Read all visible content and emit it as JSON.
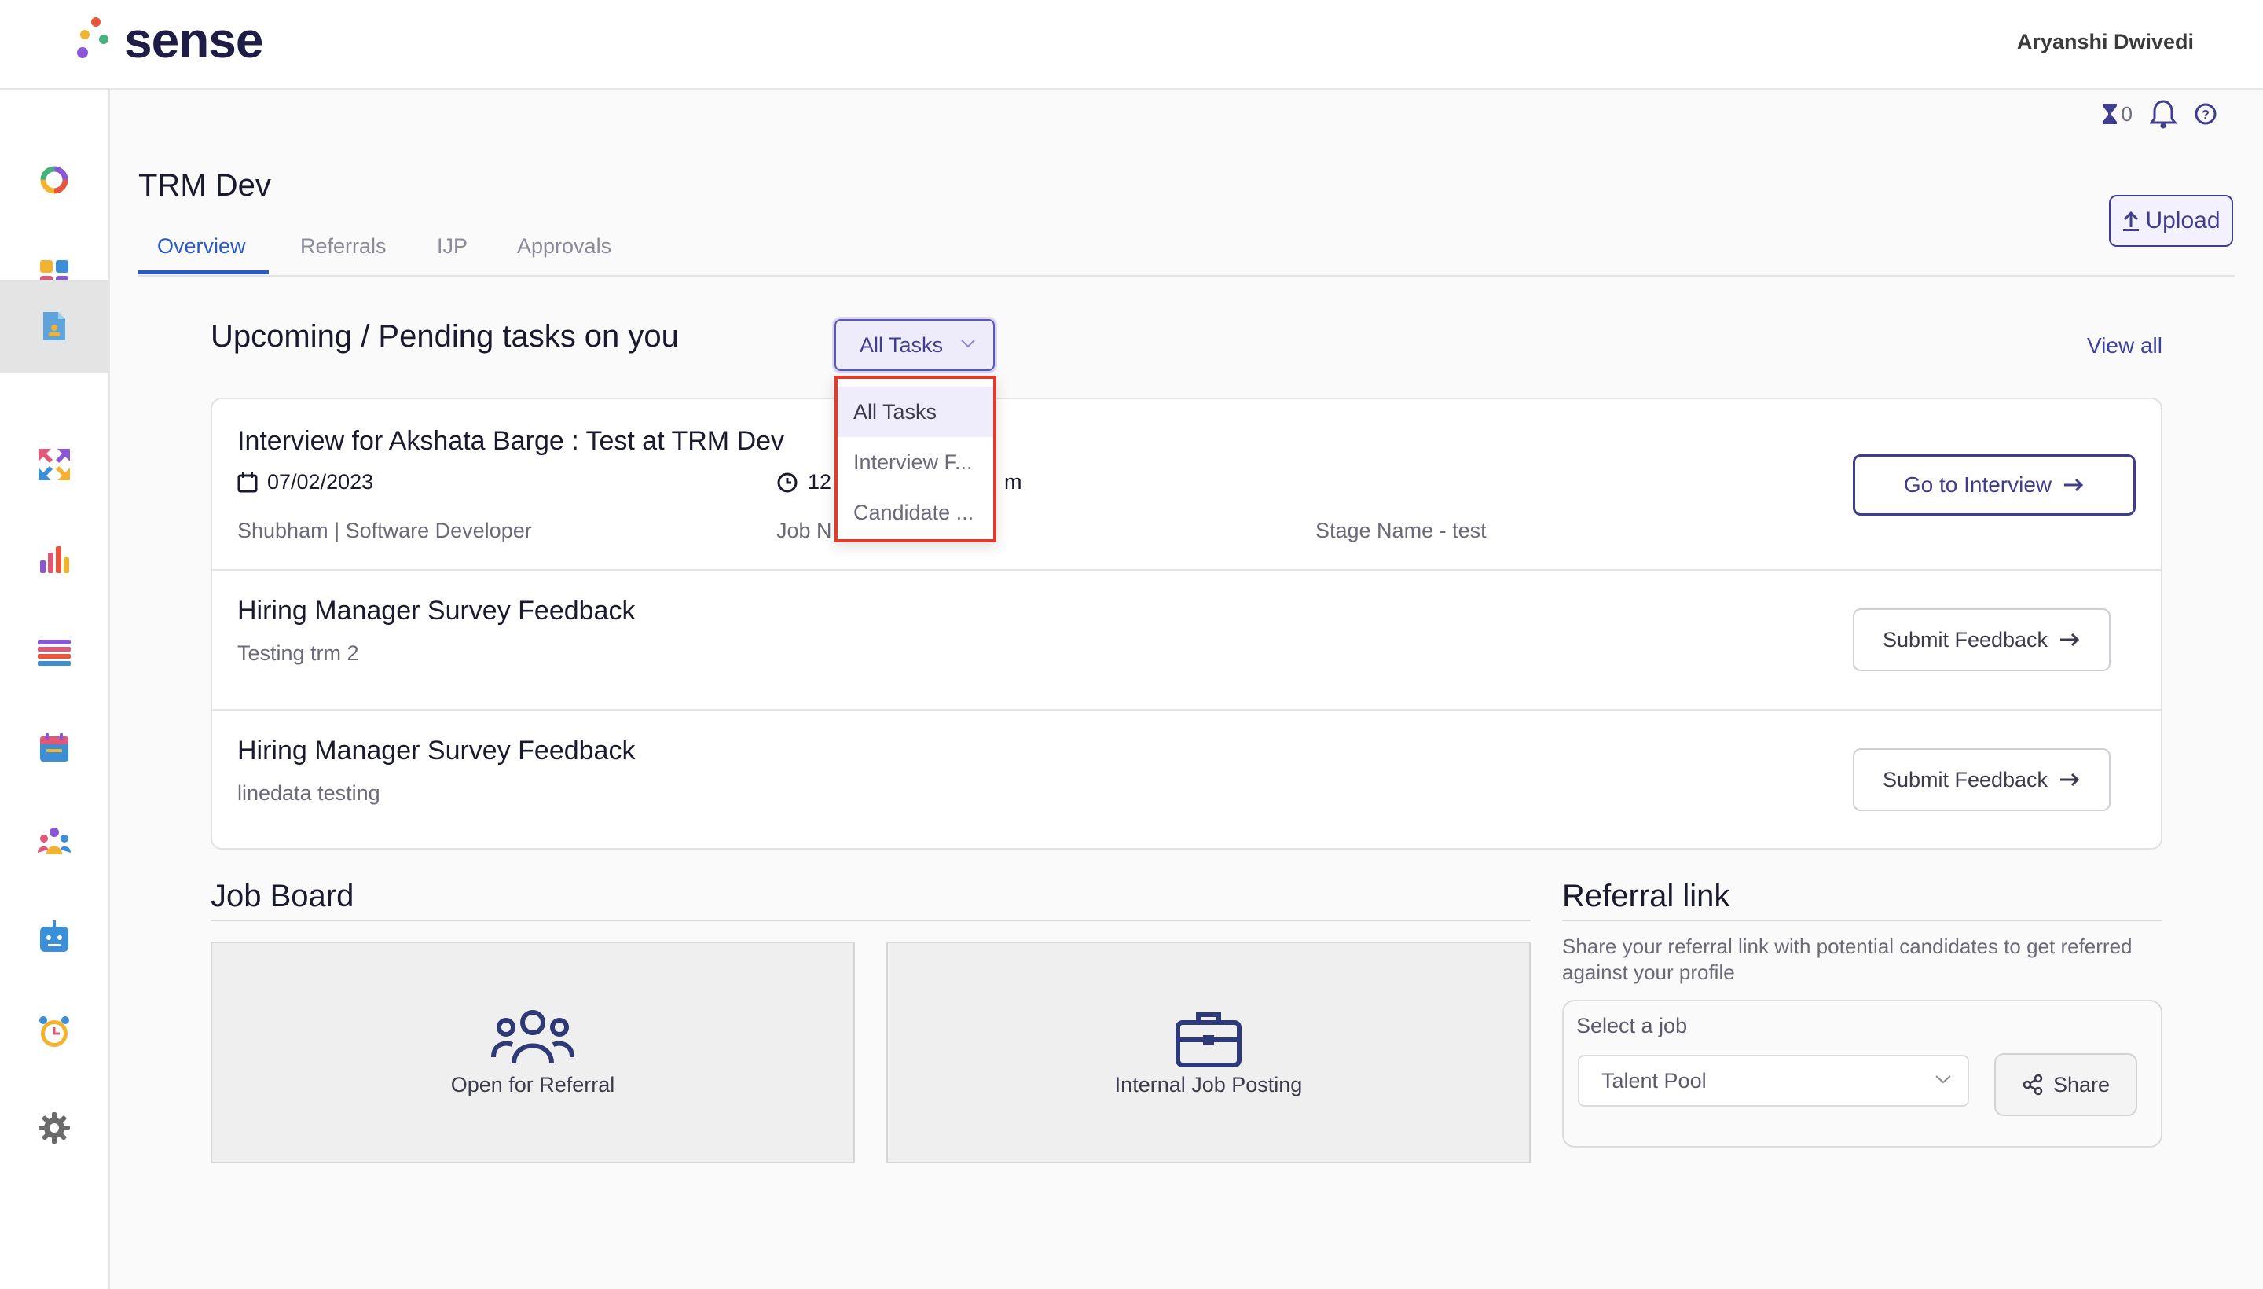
{
  "app": {
    "name": "sense",
    "user": "Aryanshi Dwivedi"
  },
  "colors": {
    "accent": "#3f3d8f",
    "tab_active": "#2b58c4",
    "highlight_box": "#e03c2d"
  },
  "sidebar": {
    "items": [
      {
        "icon": "donut-chart-icon"
      },
      {
        "icon": "dashboard-grid-icon"
      },
      {
        "icon": "referral-document-icon",
        "active": true
      },
      {
        "icon": "arrows-exchange-icon"
      },
      {
        "icon": "bar-chart-icon"
      },
      {
        "icon": "list-icon"
      },
      {
        "icon": "calendar-icon"
      },
      {
        "icon": "people-group-icon"
      },
      {
        "icon": "bot-icon"
      },
      {
        "icon": "alarm-clock-icon"
      },
      {
        "icon": "gear-icon"
      }
    ]
  },
  "iconbar": {
    "hourglass_count": "0"
  },
  "page": {
    "title": "TRM Dev",
    "tabs": [
      {
        "label": "Overview",
        "active": true
      },
      {
        "label": "Referrals"
      },
      {
        "label": "IJP"
      },
      {
        "label": "Approvals"
      }
    ],
    "upload_label": "Upload"
  },
  "tasks": {
    "heading": "Upcoming / Pending tasks on you",
    "view_all": "View all",
    "filter": {
      "selected": "All Tasks",
      "options": [
        "All Tasks",
        "Interview F...",
        "Candidate ..."
      ]
    },
    "items": [
      {
        "title": "Interview for Akshata Barge : Test at TRM Dev",
        "date": "07/02/2023",
        "time_visible": "12",
        "time_tail": "m",
        "candidate": "Shubham | Software Developer",
        "job_label": "Job N",
        "stage": "Stage Name - test",
        "action": "Go to Interview"
      },
      {
        "title": "Hiring Manager Survey Feedback",
        "subtitle": "Testing trm 2",
        "action": "Submit Feedback"
      },
      {
        "title": "Hiring Manager Survey Feedback",
        "subtitle": "linedata testing",
        "action": "Submit Feedback"
      }
    ]
  },
  "job_board": {
    "title": "Job Board",
    "cards": [
      {
        "label": "Open for Referral",
        "icon": "people-group-icon"
      },
      {
        "label": "Internal Job Posting",
        "icon": "briefcase-icon"
      }
    ]
  },
  "referral": {
    "title": "Referral link",
    "description": "Share your referral link with potential candidates to get referred against your profile",
    "select_label": "Select a job",
    "select_value": "Talent Pool",
    "share_label": "Share"
  }
}
